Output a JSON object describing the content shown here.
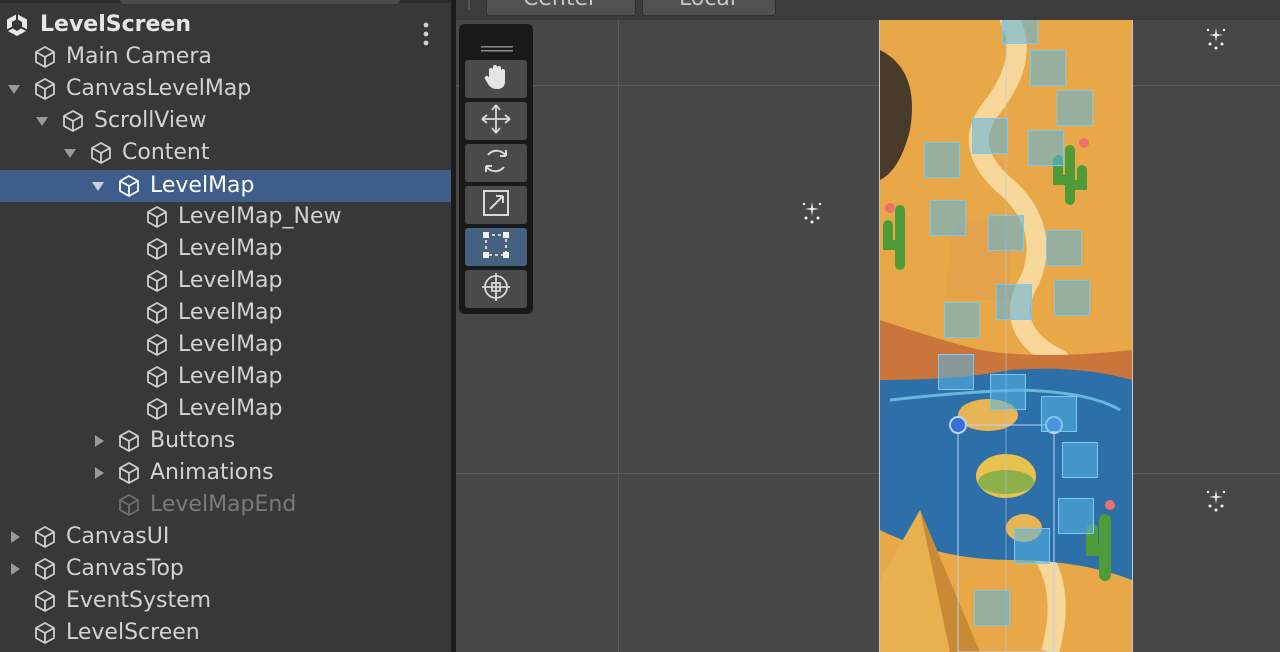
{
  "hierarchy": {
    "scene_name": "LevelScreen",
    "items": [
      {
        "label": "Main Camera"
      },
      {
        "label": "CanvasLevelMap"
      },
      {
        "label": "ScrollView"
      },
      {
        "label": "Content"
      },
      {
        "label": "LevelMap"
      },
      {
        "label": "LevelMap_New"
      },
      {
        "label": "LevelMap"
      },
      {
        "label": "LevelMap"
      },
      {
        "label": "LevelMap"
      },
      {
        "label": "LevelMap"
      },
      {
        "label": "LevelMap"
      },
      {
        "label": "LevelMap"
      },
      {
        "label": "Buttons"
      },
      {
        "label": "Animations"
      },
      {
        "label": "LevelMapEnd"
      },
      {
        "label": "CanvasUI"
      },
      {
        "label": "CanvasTop"
      },
      {
        "label": "EventSystem"
      },
      {
        "label": "LevelScreen"
      }
    ]
  },
  "scene_view": {
    "pivot_button": "Center",
    "space_button": "Local",
    "tools": [
      {
        "icon": "hand-icon"
      },
      {
        "icon": "move-icon"
      },
      {
        "icon": "rotate-icon"
      },
      {
        "icon": "scale-icon"
      },
      {
        "icon": "rect-tool-icon",
        "active": true
      },
      {
        "icon": "transform-icon"
      }
    ]
  },
  "colors": {
    "selection": "#3e5d8a",
    "panel": "#383838",
    "scene": "#474747"
  }
}
